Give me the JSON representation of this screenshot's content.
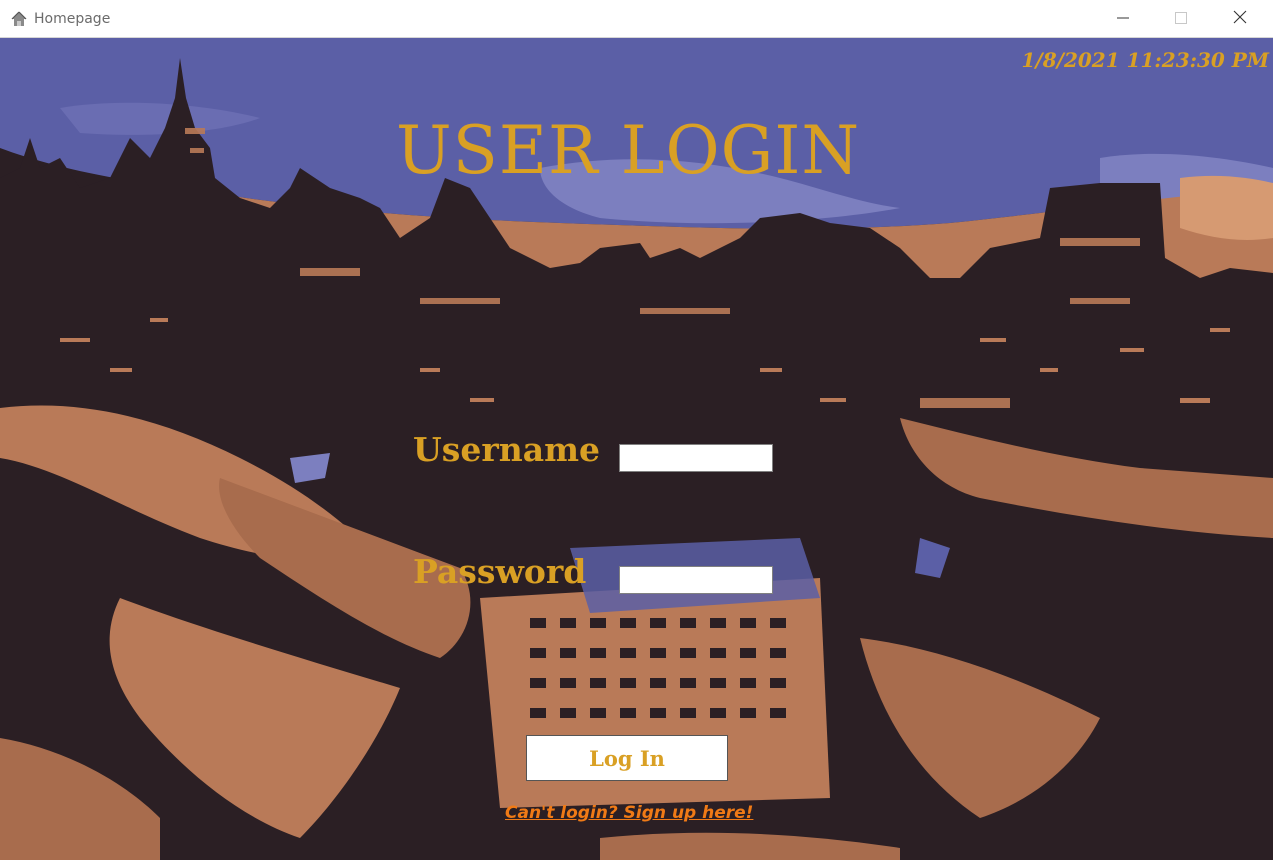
{
  "window": {
    "title": "Homepage",
    "app_icon": "house-icon",
    "controls": {
      "minimize_icon": "minimize-icon",
      "maximize_icon": "maximize-icon",
      "close_icon": "close-icon"
    }
  },
  "clock": {
    "datetime": "1/8/2021 11:23:30 PM"
  },
  "login": {
    "heading": "USER LOGIN",
    "username_label": "Username",
    "username_value": "",
    "password_label": "Password",
    "password_value": "",
    "submit_label": "Log In",
    "signup_link": "Can't login? Sign up here!"
  },
  "colors": {
    "accent_gold": "#d9a024",
    "link_orange": "#f07a16",
    "sky_blue": "#5b5fa6",
    "dusk_orange": "#b97a58",
    "dark_city": "#2b1f24"
  }
}
